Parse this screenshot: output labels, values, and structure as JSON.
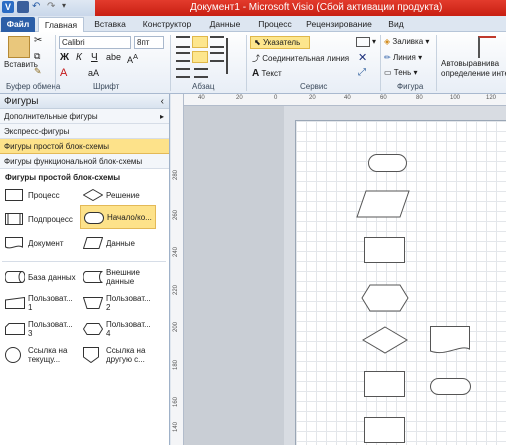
{
  "window": {
    "title": "Документ1 - Microsoft Visio (Сбой активации продукта)"
  },
  "tabs": [
    "Файл",
    "Главная",
    "Вставка",
    "Конструктор",
    "Данные",
    "Процесс",
    "Рецензирование",
    "Вид"
  ],
  "ribbon": {
    "clipboard": {
      "paste": "Вставить",
      "label": "Буфер обмена"
    },
    "font": {
      "name": "Calibri",
      "size": "8пт",
      "label": "Шрифт"
    },
    "paragraph": {
      "label": "Абзац"
    },
    "tools": {
      "pointer": "Указатель",
      "connector": "Соединительная линия",
      "text": "Текст",
      "label": "Сервис"
    },
    "shape": {
      "fill": "Заливка",
      "line": "Линия",
      "shadow": "Тень",
      "label": "Фигура"
    },
    "arrange": {
      "line1": "Автовыравнива",
      "line2": "определение инте"
    }
  },
  "shapes_panel": {
    "title": "Фигуры",
    "more": "Дополнительные фигуры",
    "quick": "Экспресс-фигуры",
    "basic_flowchart": "Фигуры простой блок-схемы",
    "cross_functional": "Фигуры функциональной блок-схемы",
    "stencil_title": "Фигуры простой блок-схемы",
    "items": [
      {
        "label": "Процесс"
      },
      {
        "label": "Решение"
      },
      {
        "label": "Подпроцесс"
      },
      {
        "label": "Начало/ко..."
      },
      {
        "label": "Документ"
      },
      {
        "label": "Данные"
      },
      {
        "label": "База данных"
      },
      {
        "label1": "Внешние",
        "label2": "данные"
      },
      {
        "label1": "Пользоват...",
        "label2": "1"
      },
      {
        "label1": "Пользоват...",
        "label2": "2"
      },
      {
        "label1": "Пользоват...",
        "label2": "3"
      },
      {
        "label1": "Пользоват...",
        "label2": "4"
      },
      {
        "label1": "Ссылка на",
        "label2": "текущу..."
      },
      {
        "label1": "Ссылка на",
        "label2": "другую с..."
      }
    ]
  },
  "hruler_ticks": [
    "40",
    "20",
    "0",
    "20",
    "40",
    "60",
    "80",
    "100",
    "120"
  ],
  "vruler_ticks": [
    "280",
    "260",
    "240",
    "220",
    "200",
    "180",
    "160",
    "140",
    "120"
  ]
}
